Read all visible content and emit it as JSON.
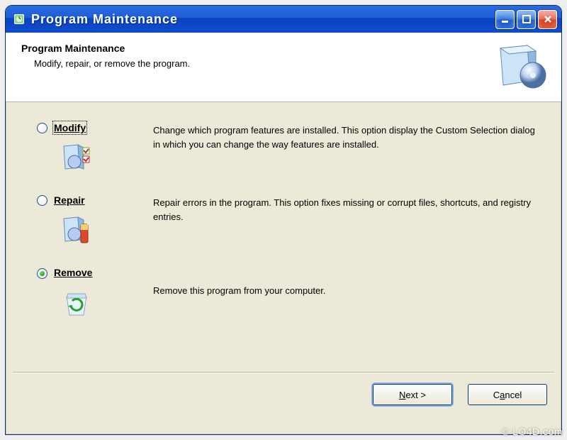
{
  "window": {
    "title": "Program Maintenance"
  },
  "header": {
    "title": "Program Maintenance",
    "subtitle": "Modify, repair, or remove the program."
  },
  "options": {
    "selected": "remove",
    "focused": "modify",
    "modify": {
      "label": "Modify",
      "description": "Change which program features are installed. This option display the Custom Selection dialog in which you can change the way features are installed."
    },
    "repair": {
      "label": "Repair",
      "description": "Repair errors in the program. This option fixes missing or corrupt files, shortcuts, and registry entries."
    },
    "remove": {
      "label": "Remove",
      "description": "Remove this program from your computer."
    }
  },
  "footer": {
    "next_label": "Next >",
    "cancel_label": "Cancel"
  },
  "watermark": "© LO4D.com"
}
